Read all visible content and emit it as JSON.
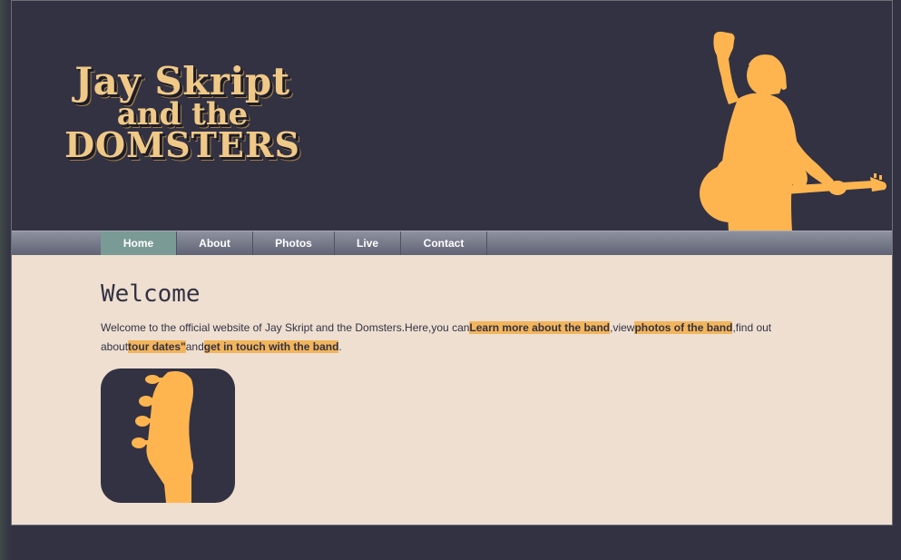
{
  "header": {
    "logo_line1": "Jay Skript",
    "logo_line2": "and the",
    "logo_line3": "DOMSTERS",
    "hero_icon": "guitarist-silhouette-icon"
  },
  "nav": {
    "items": [
      {
        "label": "Home",
        "active": true
      },
      {
        "label": "About",
        "active": false
      },
      {
        "label": "Photos",
        "active": false
      },
      {
        "label": "Live",
        "active": false
      },
      {
        "label": "Contact",
        "active": false
      }
    ]
  },
  "main": {
    "title": "Welcome",
    "intro_part1": "Welcome to the official website of Jay Skript and the Domsters.Here,you can",
    "link_about": "Learn more about the band",
    "intro_part2": ",view",
    "link_photos": "photos of the band",
    "intro_part3": ",find out about",
    "link_tour": "tour dates\"",
    "intro_part4": "and",
    "link_contact": "get in touch with the band",
    "intro_part5": ".",
    "feature_icon": "guitar-headstock-icon"
  },
  "colors": {
    "background": "#333243",
    "accent": "#ffb54f",
    "logo": "#f0c987",
    "content_bg": "#eedfd1",
    "nav_active": "#7a9a95"
  }
}
